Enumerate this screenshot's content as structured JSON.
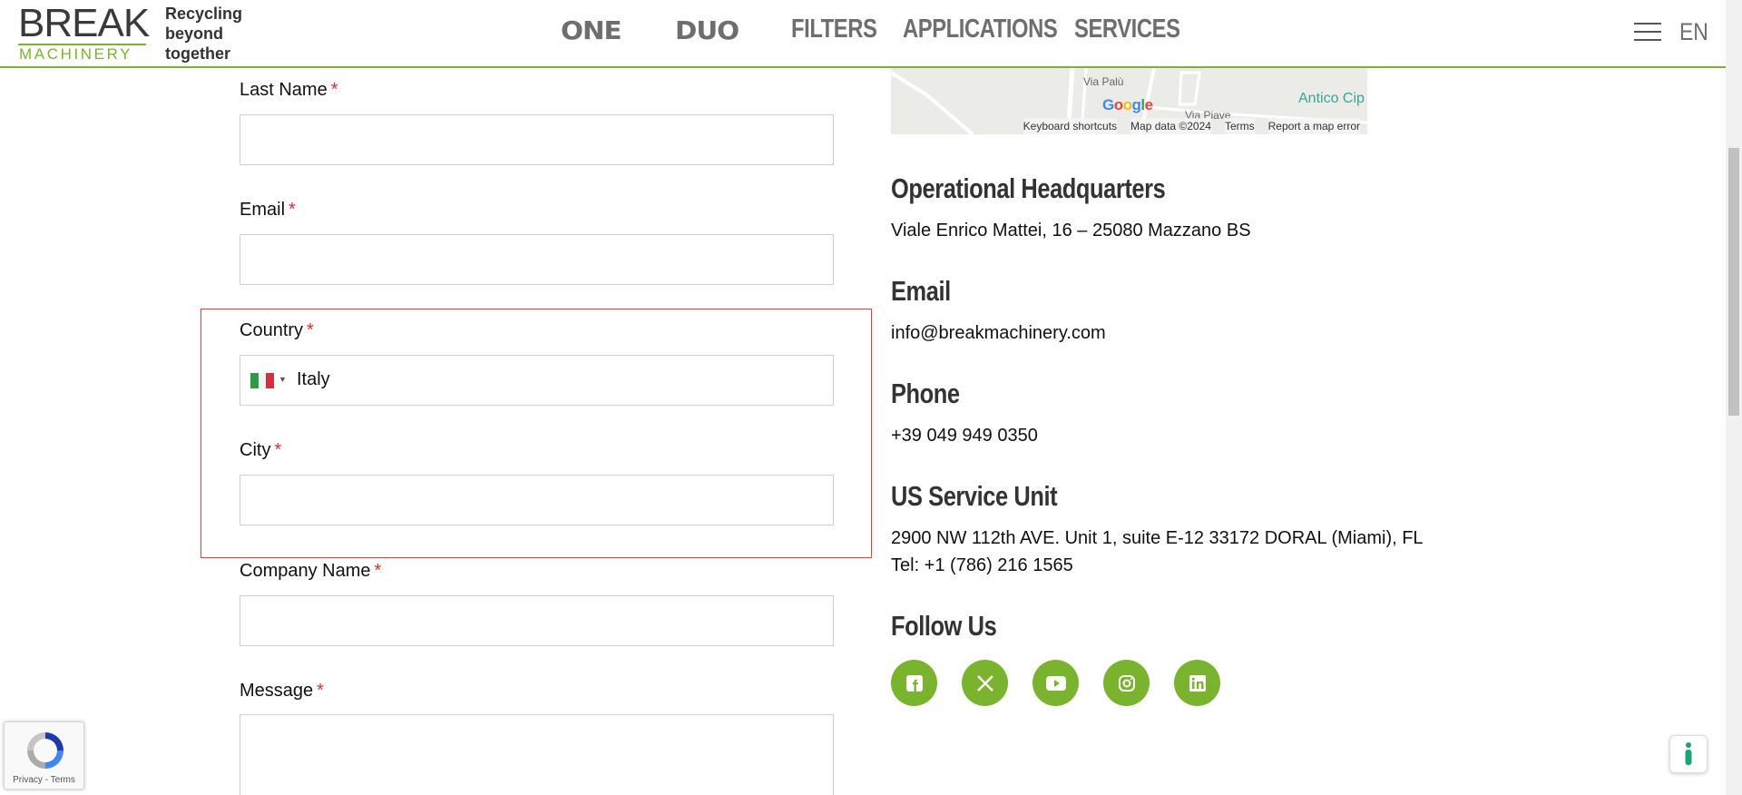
{
  "header": {
    "logo_word": "BREAK",
    "logo_sub": "MACHINERY",
    "tagline": [
      "Recycling",
      "beyond",
      "together"
    ],
    "nav": [
      "ONE",
      "DUO",
      "FILTERS",
      "APPLICATIONS",
      "SERVICES"
    ],
    "lang": "EN",
    "menu_icon": "hamburger-icon"
  },
  "form": {
    "required_mark": "*",
    "last_name_label": "Last Name",
    "email_label": "Email",
    "country_label": "Country",
    "country_value": "Italy",
    "country_flag": "italy-flag-icon",
    "city_label": "City",
    "company_label": "Company Name",
    "message_label": "Message"
  },
  "map": {
    "street_1": "Via Palù",
    "street_2": "Via Piave",
    "poi": "Antico Cip",
    "google": "Google",
    "footer": [
      "Keyboard shortcuts",
      "Map data ©2024",
      "Terms",
      "Report a map error"
    ]
  },
  "contact": {
    "hq_title": "Operational Headquarters",
    "hq_address": "Viale Enrico Mattei, 16 – 25080 Mazzano BS",
    "email_title": "Email",
    "email_value": "info@breakmachinery.com",
    "phone_title": "Phone",
    "phone_value": "+39 049 949 0350",
    "us_title": "US Service Unit",
    "us_address": "2900 NW 112th AVE. Unit 1, suite E-12 33172 DORAL (Miami), FL",
    "us_tel": "Tel: +1 (786) 216 1565",
    "follow_title": "Follow Us",
    "socials": [
      "facebook-icon",
      "x-twitter-icon",
      "youtube-icon",
      "instagram-icon",
      "linkedin-icon"
    ]
  },
  "recaptcha": {
    "terms": "Privacy - Terms"
  },
  "colors": {
    "brand_green": "#7ab32e",
    "required_red": "#e02b2b",
    "highlight_red": "#e0403f"
  }
}
